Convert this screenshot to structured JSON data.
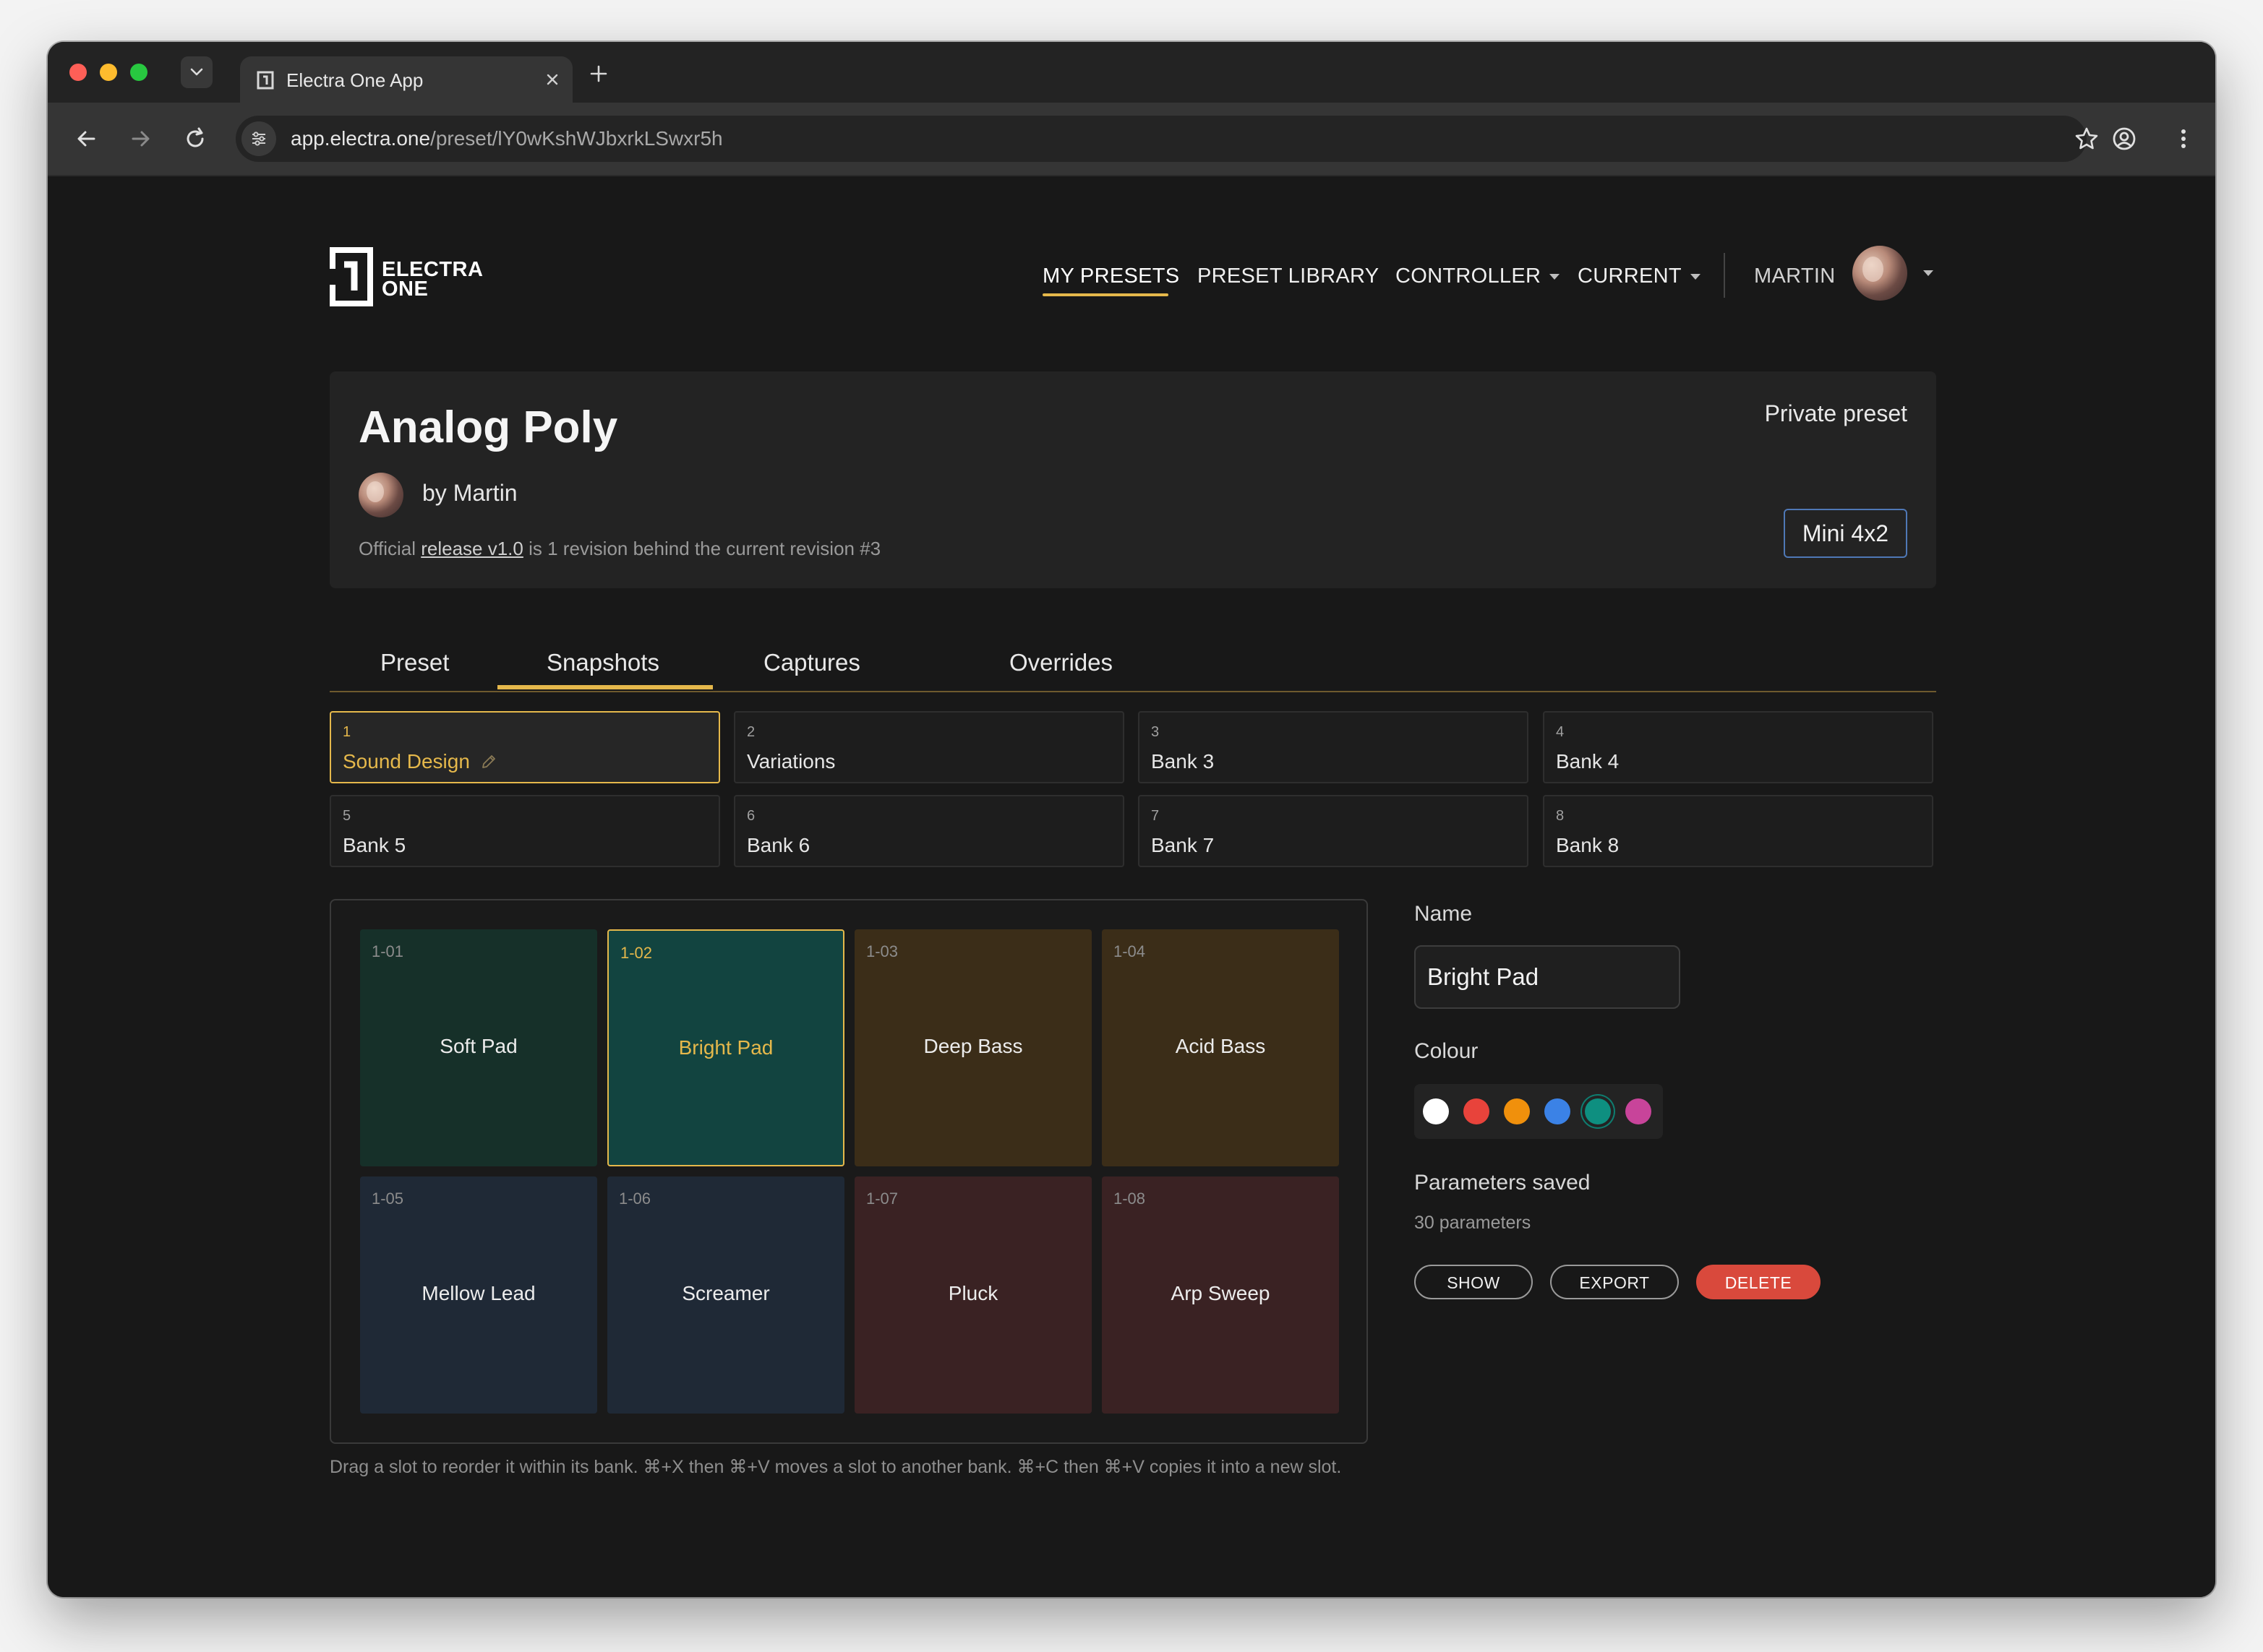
{
  "browser": {
    "tab_title": "Electra One App",
    "url_host": "app.electra.one",
    "url_path": "/preset/lY0wKshWJbxrkLSwxr5h"
  },
  "header": {
    "logo_line1": "ELECTRA",
    "logo_line2": "ONE",
    "nav": {
      "my_presets": "MY PRESETS",
      "preset_library": "PRESET LIBRARY",
      "controller": "CONTROLLER",
      "current": "CURRENT",
      "user": "MARTIN"
    }
  },
  "preset": {
    "title": "Analog Poly",
    "author": "by Martin",
    "release_prefix": "Official ",
    "release_link": "release v1.0",
    "release_suffix": " is 1 revision behind the current revision #3",
    "visibility": "Private preset",
    "model": "Mini 4x2"
  },
  "tabs": [
    "Preset",
    "Snapshots",
    "Captures",
    "Overrides"
  ],
  "banks": [
    {
      "num": "1",
      "name": "Sound Design"
    },
    {
      "num": "2",
      "name": "Variations"
    },
    {
      "num": "3",
      "name": "Bank 3"
    },
    {
      "num": "4",
      "name": "Bank 4"
    },
    {
      "num": "5",
      "name": "Bank 5"
    },
    {
      "num": "6",
      "name": "Bank 6"
    },
    {
      "num": "7",
      "name": "Bank 7"
    },
    {
      "num": "8",
      "name": "Bank 8"
    }
  ],
  "slots": [
    {
      "id": "1-01",
      "name": "Soft Pad"
    },
    {
      "id": "1-02",
      "name": "Bright Pad"
    },
    {
      "id": "1-03",
      "name": "Deep Bass"
    },
    {
      "id": "1-04",
      "name": "Acid Bass"
    },
    {
      "id": "1-05",
      "name": "Mellow Lead"
    },
    {
      "id": "1-06",
      "name": "Screamer"
    },
    {
      "id": "1-07",
      "name": "Pluck"
    },
    {
      "id": "1-08",
      "name": "Arp Sweep"
    }
  ],
  "hint": "Drag a slot to reorder it within its bank. ⌘+X then ⌘+V moves a slot to another bank. ⌘+C then ⌘+V copies it into a new slot.",
  "details": {
    "name_label": "Name",
    "name_value": "Bright Pad",
    "colour_label": "Colour",
    "colours": [
      "#ffffff",
      "#e8433b",
      "#f0900c",
      "#3b82e6",
      "#0e8f80",
      "#c8449a"
    ],
    "selected_colour": "#0e8f80",
    "params_label": "Parameters saved",
    "params_count": "30 parameters",
    "show": "SHOW",
    "export": "EXPORT",
    "delete": "DELETE"
  },
  "colors": {
    "accent": "#e5b84b",
    "model_border": "#4f78b6",
    "delete": "#d9493c"
  },
  "icons": [
    "chevron-down-icon",
    "electra-favicon-icon",
    "close-icon",
    "plus-icon",
    "back-arrow-icon",
    "forward-arrow-icon",
    "reload-icon",
    "site-settings-icon",
    "star-icon",
    "profile-icon",
    "more-vert-icon",
    "electra-logo-icon",
    "pencil-icon"
  ]
}
